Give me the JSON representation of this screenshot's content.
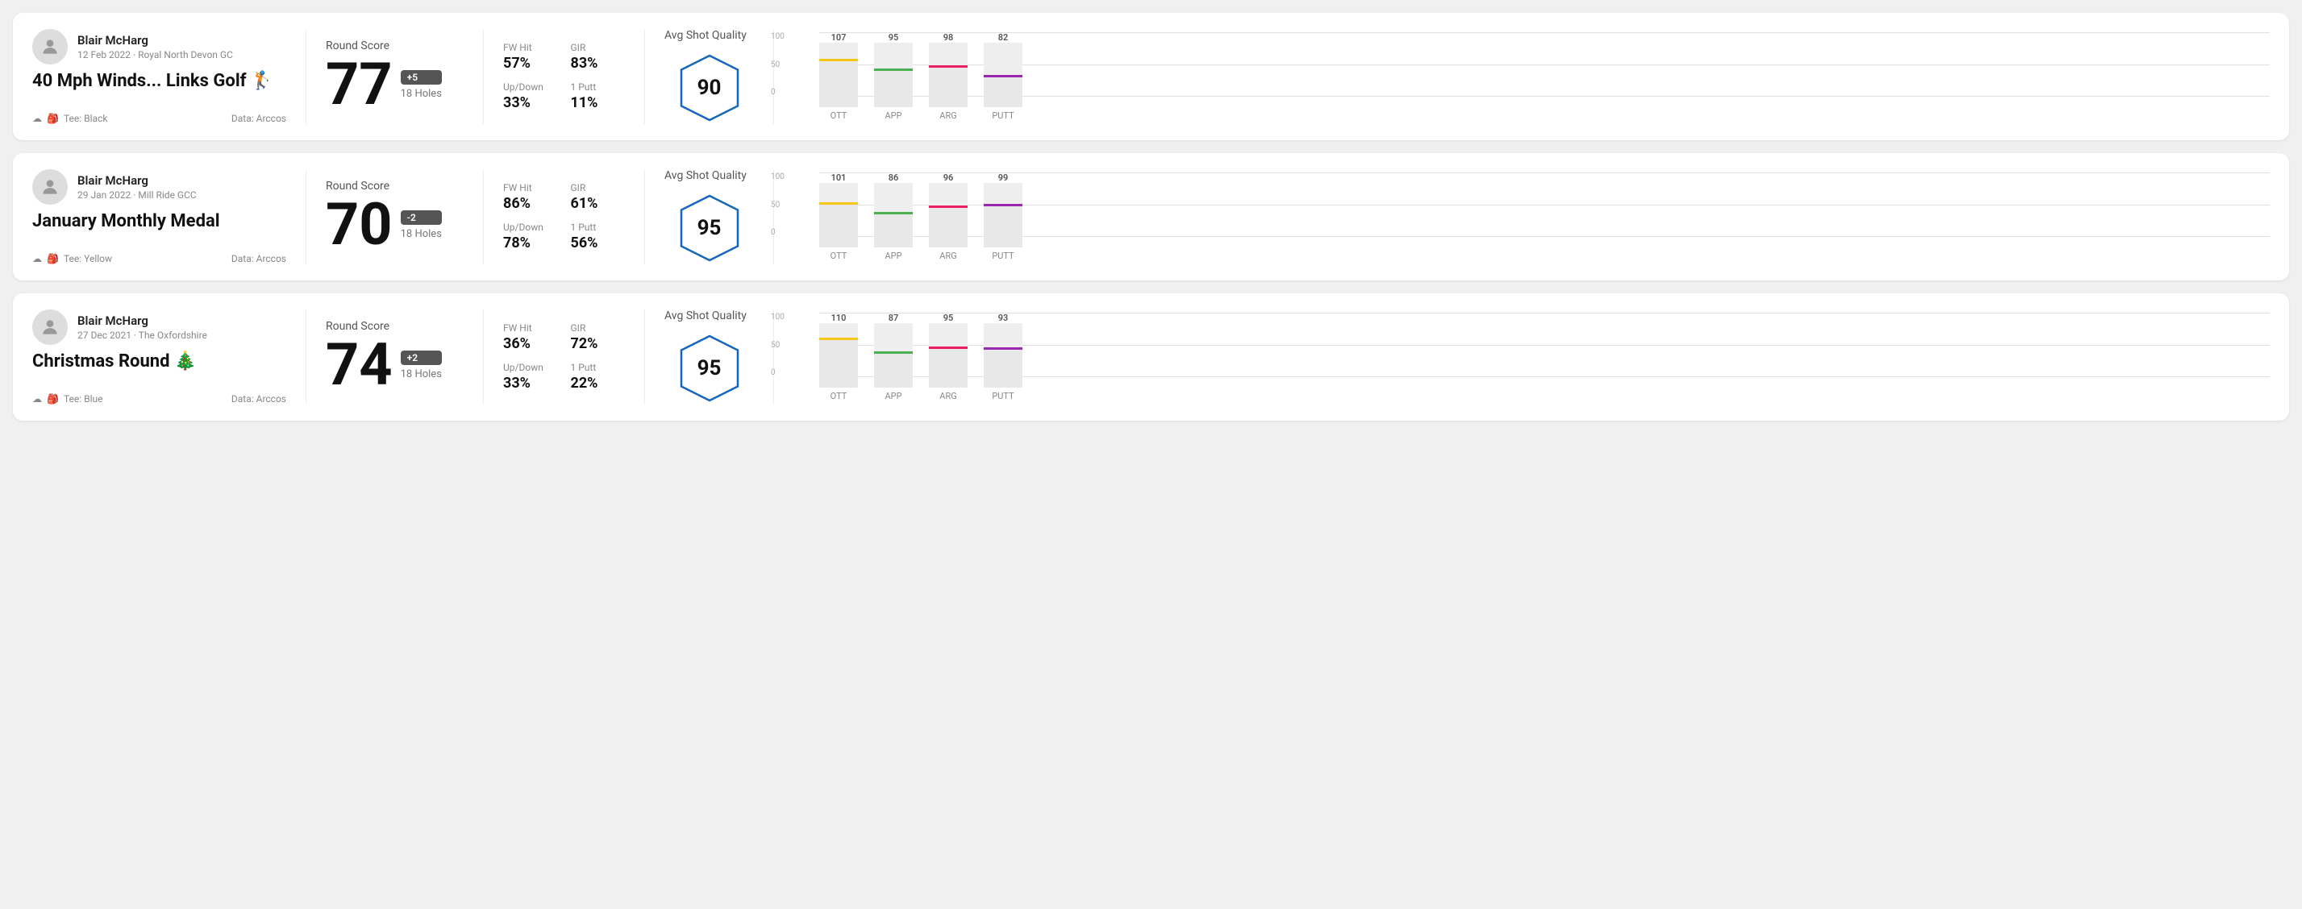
{
  "rounds": [
    {
      "id": "round1",
      "userName": "Blair McHarg",
      "date": "12 Feb 2022",
      "course": "Royal North Devon GC",
      "title": "40 Mph Winds... Links Golf 🏌",
      "tee": "Black",
      "data": "Arccos",
      "score": "77",
      "scoreDiff": "+5",
      "scoreHoles": "18 Holes",
      "fwHit": "57%",
      "gir": "83%",
      "upDown": "33%",
      "onePutt": "11%",
      "avgQuality": "90",
      "bars": [
        {
          "label": "OTT",
          "value": 107,
          "color": "#f5c518",
          "pct": 75
        },
        {
          "label": "APP",
          "value": 95,
          "color": "#4caf50",
          "pct": 60
        },
        {
          "label": "ARG",
          "value": 98,
          "color": "#e91e63",
          "pct": 65
        },
        {
          "label": "PUTT",
          "value": 82,
          "color": "#9c27b0",
          "pct": 50
        }
      ]
    },
    {
      "id": "round2",
      "userName": "Blair McHarg",
      "date": "29 Jan 2022",
      "course": "Mill Ride GCC",
      "title": "January Monthly Medal",
      "tee": "Yellow",
      "data": "Arccos",
      "score": "70",
      "scoreDiff": "-2",
      "scoreHoles": "18 Holes",
      "fwHit": "86%",
      "gir": "61%",
      "upDown": "78%",
      "onePutt": "56%",
      "avgQuality": "95",
      "bars": [
        {
          "label": "OTT",
          "value": 101,
          "color": "#f5c518",
          "pct": 70
        },
        {
          "label": "APP",
          "value": 86,
          "color": "#4caf50",
          "pct": 55
        },
        {
          "label": "ARG",
          "value": 96,
          "color": "#e91e63",
          "pct": 65
        },
        {
          "label": "PUTT",
          "value": 99,
          "color": "#9c27b0",
          "pct": 68
        }
      ]
    },
    {
      "id": "round3",
      "userName": "Blair McHarg",
      "date": "27 Dec 2021",
      "course": "The Oxfordshire",
      "title": "Christmas Round 🎄",
      "tee": "Blue",
      "data": "Arccos",
      "score": "74",
      "scoreDiff": "+2",
      "scoreHoles": "18 Holes",
      "fwHit": "36%",
      "gir": "72%",
      "upDown": "33%",
      "onePutt": "22%",
      "avgQuality": "95",
      "bars": [
        {
          "label": "OTT",
          "value": 110,
          "color": "#f5c518",
          "pct": 78
        },
        {
          "label": "APP",
          "value": 87,
          "color": "#4caf50",
          "pct": 56
        },
        {
          "label": "ARG",
          "value": 95,
          "color": "#e91e63",
          "pct": 64
        },
        {
          "label": "PUTT",
          "value": 93,
          "color": "#9c27b0",
          "pct": 62
        }
      ]
    }
  ],
  "labels": {
    "roundScore": "Round Score",
    "fwHit": "FW Hit",
    "gir": "GIR",
    "upDown": "Up/Down",
    "onePutt": "1 Putt",
    "avgShotQuality": "Avg Shot Quality",
    "tee": "Tee:",
    "data": "Data:"
  }
}
